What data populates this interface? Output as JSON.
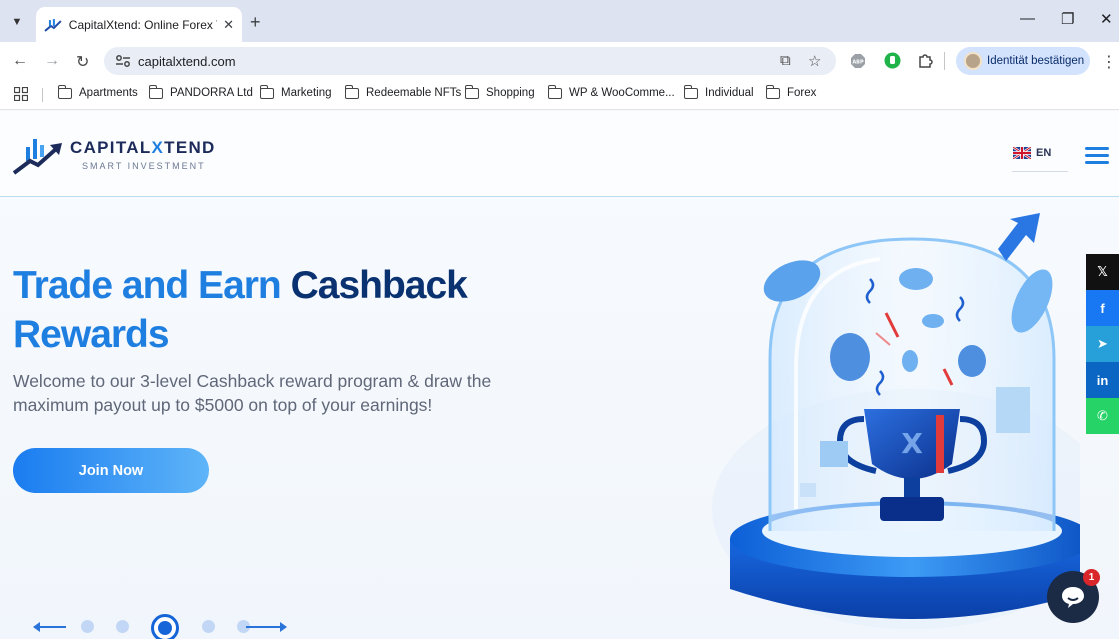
{
  "browser": {
    "tab_title": "CapitalXtend: Online Forex Trad",
    "url": "capitalxtend.com",
    "profile_label": "Identität bestätigen",
    "bookmarks": [
      "Apartments",
      "PANDORRA Ltd",
      "Marketing",
      "Redeemable NFTs",
      "Shopping",
      "WP & WooComme...",
      "Individual",
      "Forex"
    ]
  },
  "site": {
    "logo": {
      "name_part1": "CAPITAL",
      "name_part2": "X",
      "name_part3": "TEND",
      "tagline": "SMART INVESTMENT"
    },
    "language": "EN",
    "hero": {
      "title_light_1": "Trade and Earn",
      "title_dark": "Cashback",
      "title_light_2": "Rewards",
      "subtitle": "Welcome to our 3-level Cashback reward program & draw the maximum payout up to $5000 on top of your earnings!",
      "cta": "Join Now"
    },
    "slider": {
      "count": 5,
      "active": 3
    },
    "share_buttons": [
      {
        "icon": "x-icon",
        "label": "𝕏",
        "color": "#111111"
      },
      {
        "icon": "facebook-icon",
        "label": "f",
        "color": "#1877f2"
      },
      {
        "icon": "telegram-icon",
        "label": "➤",
        "color": "#279fd9"
      },
      {
        "icon": "linkedin-icon",
        "label": "in",
        "color": "#0a66c2"
      },
      {
        "icon": "whatsapp-icon",
        "label": "✆",
        "color": "#25d366"
      }
    ],
    "chat_badge": "1"
  }
}
